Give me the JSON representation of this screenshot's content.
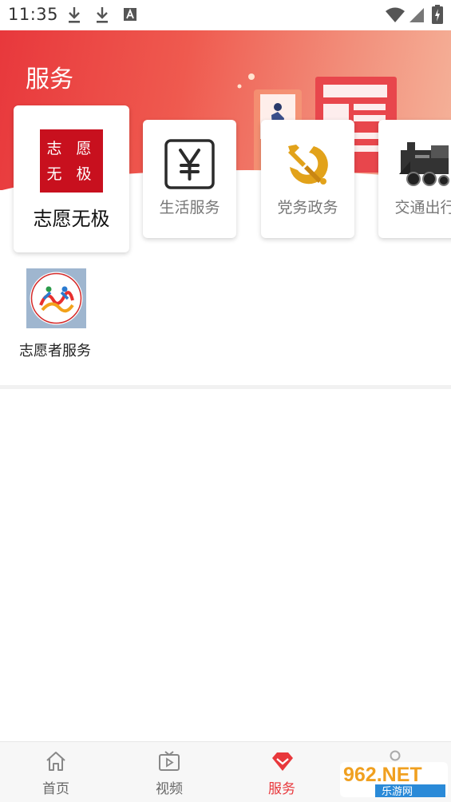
{
  "status_bar": {
    "time": "11:35",
    "icons": [
      "download-icon",
      "download-icon",
      "font-a-icon",
      "wifi-icon",
      "signal-icon",
      "battery-icon"
    ]
  },
  "header": {
    "title": "服务"
  },
  "services": {
    "main": {
      "logo_text_line1": "志 愿",
      "logo_text_line2": "无 极",
      "label": "志愿无极",
      "icon": "volunteer-logo"
    },
    "items": [
      {
        "label": "生活服务",
        "icon": "yen-icon"
      },
      {
        "label": "党务政务",
        "icon": "hammer-sickle-icon"
      },
      {
        "label": "交通出行",
        "icon": "train-icon"
      }
    ]
  },
  "volunteer": {
    "label": "志愿者服务",
    "icon": "volunteer-service-logo"
  },
  "bottom_nav": {
    "items": [
      {
        "label": "首页",
        "icon": "home-icon",
        "active": false
      },
      {
        "label": "视频",
        "icon": "tv-icon",
        "active": false
      },
      {
        "label": "服务",
        "icon": "diamond-icon",
        "active": true
      }
    ]
  },
  "watermark": {
    "text_top": "962.NET",
    "text_bottom": "乐游网"
  },
  "colors": {
    "brand_red": "#e8383c",
    "banner_end": "#f5b39a",
    "logo_red": "#c8101e",
    "inactive_text": "#666666"
  }
}
